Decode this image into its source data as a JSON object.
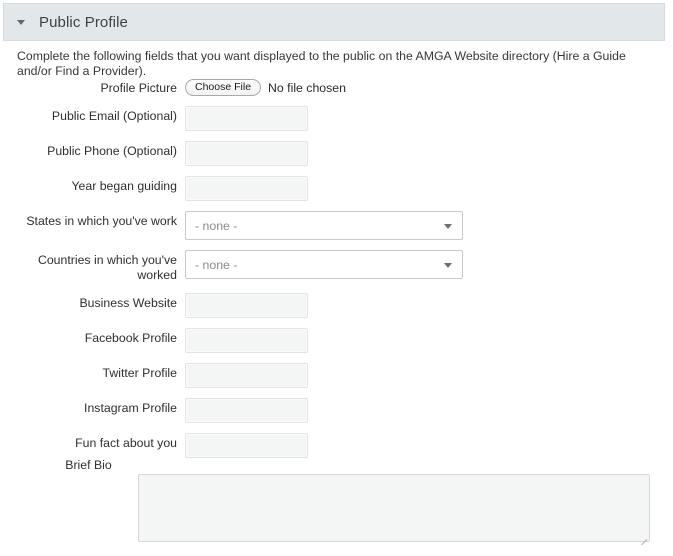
{
  "section": {
    "title": "Public Profile",
    "collapse_icon": "chevron-down-icon",
    "header_bg": "#e2e8ea"
  },
  "intro": {
    "text": "Complete the following fields that you want displayed to the public on the AMGA Website directory (Hire a Guide and/or Find a Provider)."
  },
  "fields": {
    "profile_picture": {
      "label": "Profile Picture",
      "button_label": "Choose File",
      "status": "No file chosen"
    },
    "public_email": {
      "label": "Public Email (Optional)",
      "value": "",
      "placeholder": ""
    },
    "public_phone": {
      "label": "Public Phone (Optional)",
      "value": "",
      "placeholder": ""
    },
    "year_began": {
      "label": "Year began guiding",
      "value": "",
      "placeholder": ""
    },
    "states": {
      "label": "States in which you've work",
      "selected": "- none -",
      "arrow_icon": "triangle-down-icon"
    },
    "countries": {
      "label": "Countries in which you've worked",
      "selected": "- none -",
      "arrow_icon": "triangle-down-icon"
    },
    "business_website": {
      "label": "Business Website",
      "value": "",
      "placeholder": ""
    },
    "facebook": {
      "label": "Facebook Profile",
      "value": "",
      "placeholder": ""
    },
    "twitter": {
      "label": "Twitter Profile",
      "value": "",
      "placeholder": ""
    },
    "instagram": {
      "label": "Instagram Profile",
      "value": "",
      "placeholder": ""
    },
    "fun_fact": {
      "label": "Fun fact about you",
      "value": "",
      "placeholder": ""
    },
    "brief_bio": {
      "label": "Brief Bio",
      "value": "",
      "placeholder": ""
    }
  }
}
